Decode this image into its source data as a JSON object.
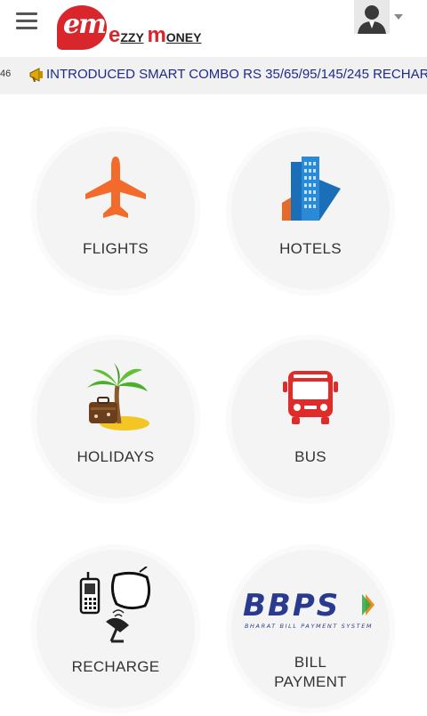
{
  "header": {
    "logo_em": "em",
    "logo_e": "e",
    "logo_zzy": "ZZY",
    "logo_m": "m",
    "logo_oney": "ONEY"
  },
  "ticker": {
    "prefix": "46",
    "text": "INTRODUCED SMART COMBO RS 35/65/95/145/245 RECHAR"
  },
  "services": [
    {
      "label": "FLIGHTS",
      "icon": "airplane-icon"
    },
    {
      "label": "HOTELS",
      "icon": "building-icon"
    },
    {
      "label": "HOLIDAYS",
      "icon": "palm-tree-icon"
    },
    {
      "label": "BUS",
      "icon": "bus-icon"
    },
    {
      "label": "RECHARGE",
      "icon": "mobile-tv-dish-icon"
    },
    {
      "label_line1": "BILL",
      "label_line2": "PAYMENT",
      "icon": "bbps-logo",
      "bbps_text": "BBPS",
      "bbps_tagline": "BHARAT BILL PAYMENT SYSTEM"
    }
  ],
  "colors": {
    "brand_red": "#d8262c",
    "ticker_text": "#1e2a8a",
    "flight_orange": "#f26b2b",
    "bus_red": "#e02b2b",
    "bbps_blue": "#2a3b8f"
  }
}
